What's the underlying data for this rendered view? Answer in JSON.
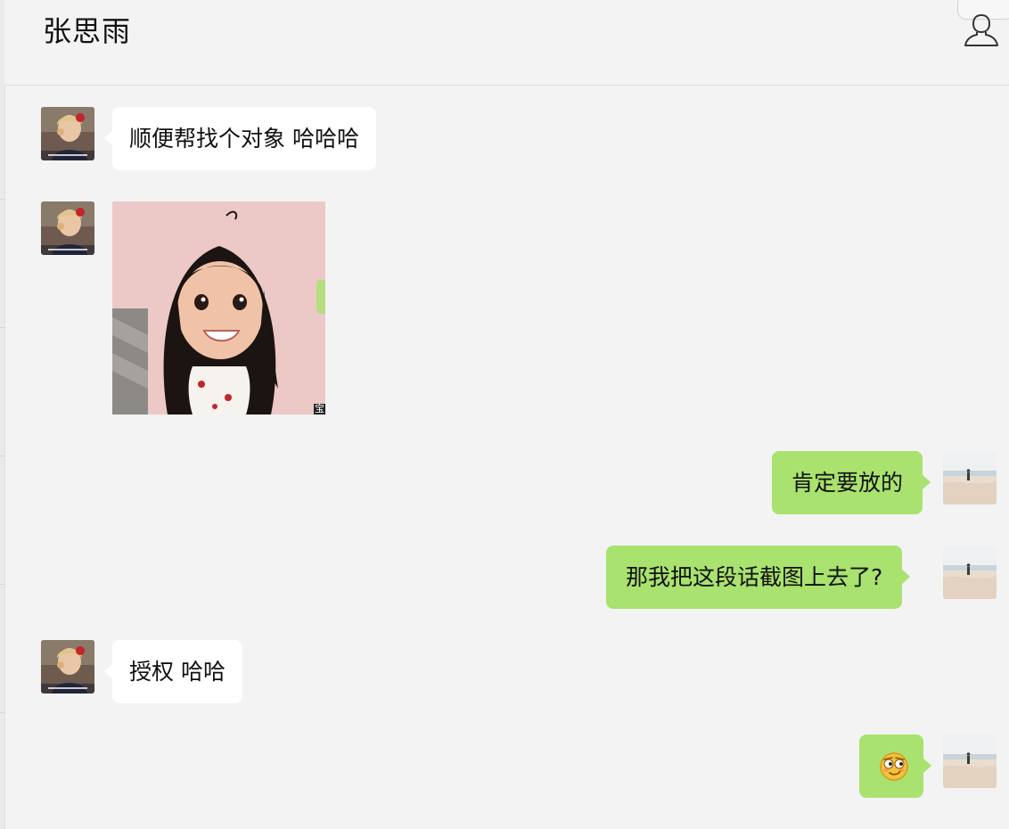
{
  "header": {
    "title": "张思雨"
  },
  "messages": [
    {
      "sender": "contact",
      "type": "text",
      "text": "顺便帮找个对象  哈哈哈"
    },
    {
      "sender": "contact",
      "type": "image",
      "badge": "宝"
    },
    {
      "sender": "me",
      "type": "text",
      "text": "肯定要放的"
    },
    {
      "sender": "me",
      "type": "text",
      "text": "那我把这段话截图上去了?"
    },
    {
      "sender": "contact",
      "type": "text",
      "text": "授权 哈哈"
    },
    {
      "sender": "me",
      "type": "emoji",
      "icon": "smirk-face-emoji-icon"
    }
  ],
  "colors": {
    "background": "#f3f3f3",
    "incoming_bubble": "#ffffff",
    "outgoing_bubble": "#a9e26e"
  }
}
